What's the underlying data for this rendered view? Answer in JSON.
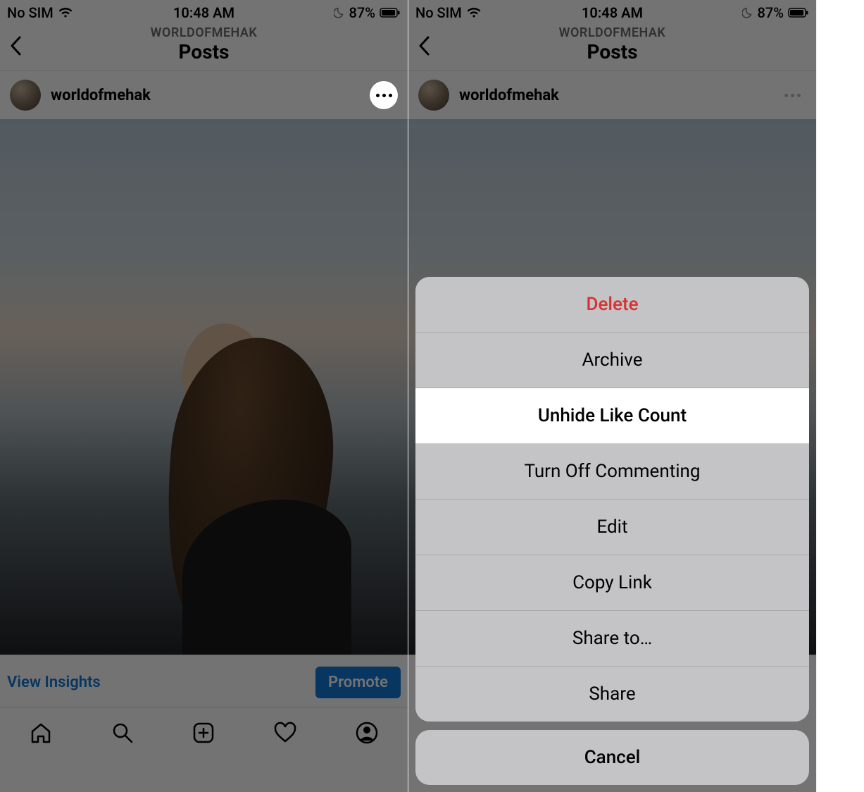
{
  "status": {
    "carrier": "No SIM",
    "time": "10:48 AM",
    "battery_percent": "87%"
  },
  "header": {
    "subtitle": "WORLDOFMEHAK",
    "title": "Posts"
  },
  "post": {
    "username": "worldofmehak"
  },
  "insights": {
    "view_label": "View Insights",
    "promote_label": "Promote"
  },
  "action_sheet": {
    "items": [
      {
        "label": "Delete",
        "style": "destructive"
      },
      {
        "label": "Archive",
        "style": "normal"
      },
      {
        "label": "Unhide Like Count",
        "style": "highlight"
      },
      {
        "label": "Turn Off Commenting",
        "style": "normal"
      },
      {
        "label": "Edit",
        "style": "normal"
      },
      {
        "label": "Copy Link",
        "style": "normal"
      },
      {
        "label": "Share to…",
        "style": "normal"
      },
      {
        "label": "Share",
        "style": "normal"
      }
    ],
    "cancel_label": "Cancel"
  }
}
